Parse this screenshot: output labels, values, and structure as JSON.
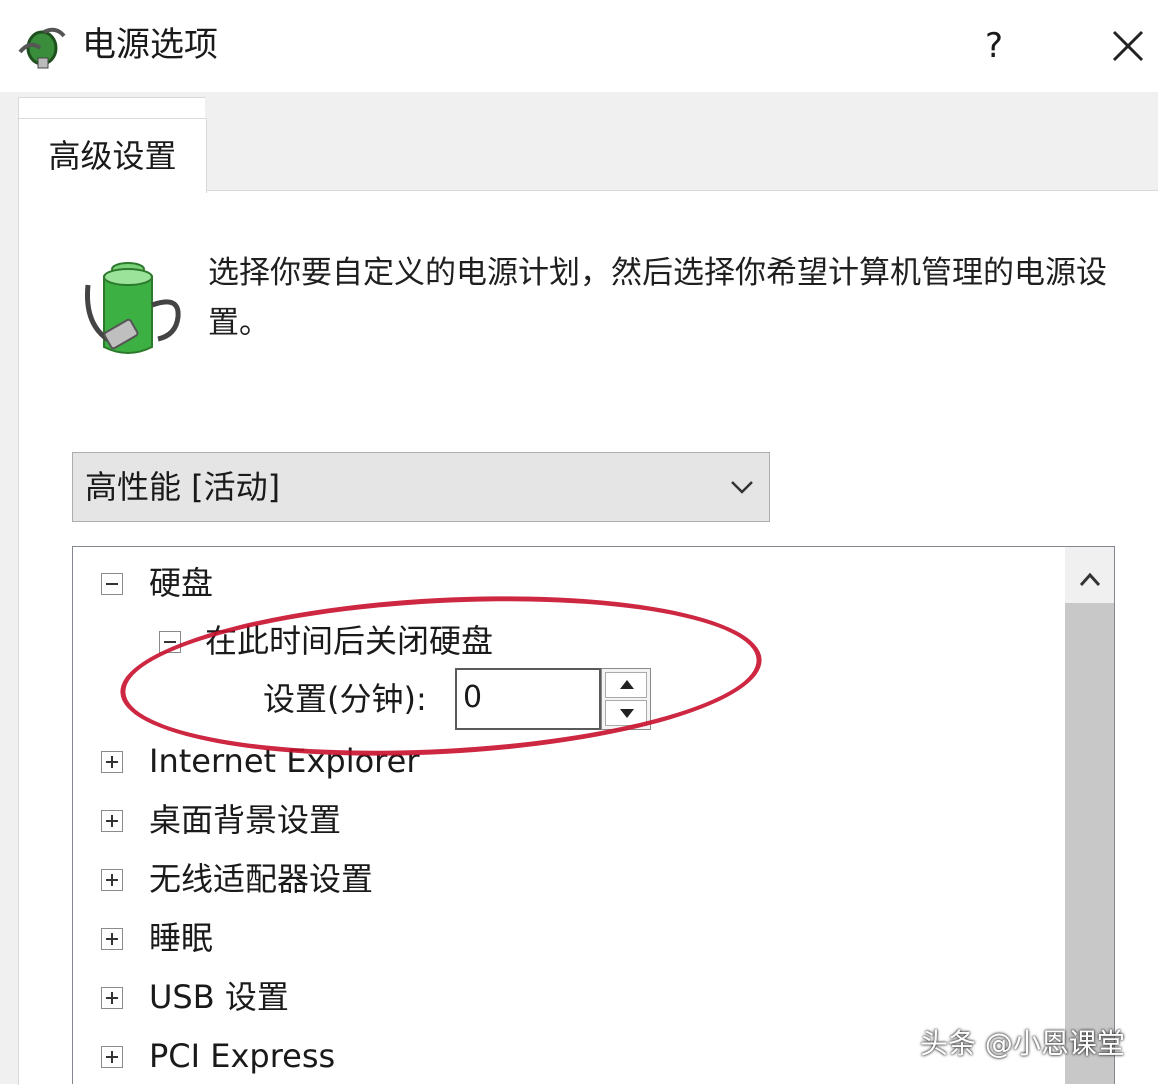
{
  "window": {
    "title": "电源选项",
    "help": "?"
  },
  "tabs": [
    {
      "label": "高级设置"
    }
  ],
  "description": "选择你要自定义的电源计划，然后选择你希望计算机管理的电源设置。",
  "plan_select": {
    "value": "高性能 [活动]"
  },
  "tree": {
    "hard_disk": "硬盘",
    "turn_off_after": "在此时间后关闭硬盘",
    "setting_label": "设置(分钟):",
    "setting_value": "0",
    "items": [
      "Internet Explorer",
      "桌面背景设置",
      "无线适配器设置",
      "睡眠",
      "USB 设置",
      "PCI Express"
    ]
  },
  "colors": {
    "annotation": "#c8102e",
    "battery": "#3cb043"
  },
  "watermark": "头条 @小恩课堂"
}
